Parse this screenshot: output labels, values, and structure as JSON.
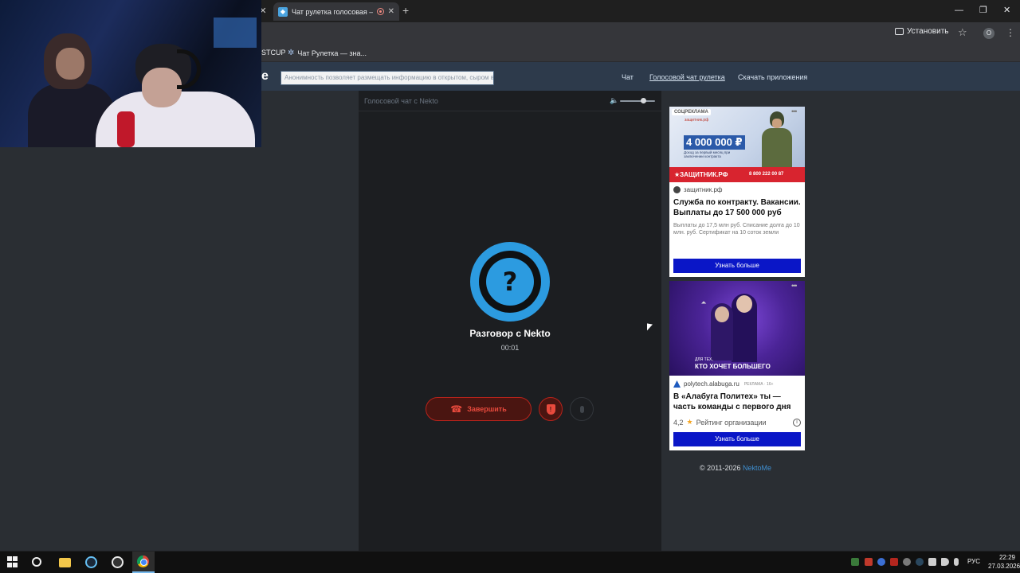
{
  "browser": {
    "tab_title": "Чат рулетка голосовая — ",
    "install_label": "Установить",
    "profile_initial": "O",
    "bookmarks": [
      {
        "label": "STCUP"
      },
      {
        "label": "Чат Рулетка — зна..."
      }
    ]
  },
  "site": {
    "logo_text": "e",
    "notice_text": "Анонимность позволяет размещать информацию в открытом, сыром виде!",
    "nav": [
      "Чат",
      "Голосовой чат рулетка",
      "Скачать приложения"
    ],
    "active_nav": "Голосовой чат рулетка"
  },
  "chat": {
    "header_label": "Голосовой чат с Nekto",
    "avatar_symbol": "?",
    "conversation_title": "Разговор с Nekto",
    "timer": "00:01",
    "end_button_label": "Завершить",
    "volume_level_percent": 65
  },
  "ads": [
    {
      "badge": "СОЦРЕКЛАМА",
      "image_sub": "защитник.рф",
      "image_big": "4 000 000 ₽",
      "image_small": "Доход за первый месяц при заключении контракта",
      "image_brand": "★ЗАЩИТНИК.РФ",
      "image_phone": "8 800 222 00 87",
      "domain": "защитник.рф",
      "title": "Служба по контракту. Вакансии. Выплаты до 17 500 000 руб",
      "description": "Выплаты до 17,5 млн руб. Списание долга до 10 млн. руб. Сертификат на 10 соток земли",
      "cta": "Узнать больше"
    },
    {
      "image_for": "ДЛЯ ТЕХ,",
      "image_slogan": "КТО ХОЧЕТ БОЛЬШЕГО",
      "domain": "polytech.alabuga.ru",
      "tag": "РЕКЛАМА · 16+",
      "title": "В «Алабуга Политех» ты — часть команды с первого дня",
      "rating_value": "4,2",
      "rating_label": "Рейтинг организации",
      "cta": "Узнать больше"
    }
  ],
  "footer": {
    "copyright_text": "© 2011-2026 ",
    "copyright_link": "NektoMe"
  },
  "taskbar": {
    "lang": "РУС",
    "time": "22:29",
    "date": "27.03.2026"
  },
  "colors": {
    "accent_blue": "#2c9be0",
    "end_call_red": "#e84a3d",
    "header_bg": "#2d3a4b",
    "ad_cta": "#0a16c7"
  }
}
